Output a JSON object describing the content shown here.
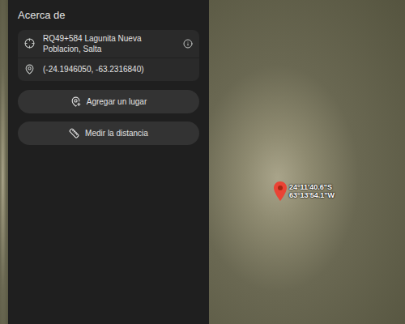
{
  "panel": {
    "title": "Acerca de",
    "plus_code": "RQ49+584 Lagunita Nueva Poblacion, Salta",
    "coordinates": "(-24.1946050, -63.2316840)",
    "buttons": [
      {
        "label": "Agregar un lugar",
        "icon": "add-place"
      },
      {
        "label": "Medir la distancia",
        "icon": "ruler"
      }
    ]
  },
  "map": {
    "pin": {
      "label_lines": [
        "24°11'40.6\"S",
        "63°13'54.1\"W"
      ]
    }
  }
}
